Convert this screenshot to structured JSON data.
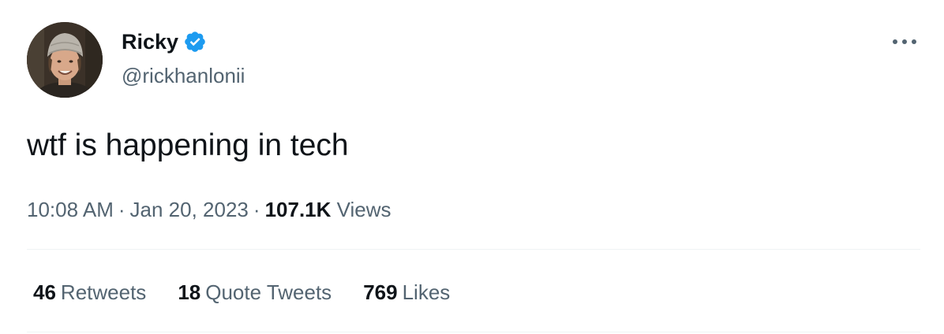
{
  "user": {
    "display_name": "Ricky",
    "handle": "@rickhanlonii",
    "verified": true,
    "verified_color": "#1d9bf0"
  },
  "tweet": {
    "text": "wtf is happening in tech",
    "time": "10:08 AM",
    "date": "Jan 20, 2023",
    "separator": "·",
    "views_count": "107.1K",
    "views_label": "Views"
  },
  "stats": [
    {
      "count": "46",
      "label": "Retweets"
    },
    {
      "count": "18",
      "label": "Quote Tweets"
    },
    {
      "count": "769",
      "label": "Likes"
    }
  ],
  "icons": {
    "avatar": "avatar-photo",
    "verified": "verified-badge-icon",
    "more": "more-options-icon"
  },
  "colors": {
    "text_primary": "#0f1419",
    "text_secondary": "#536471",
    "divider": "#eff3f4"
  }
}
